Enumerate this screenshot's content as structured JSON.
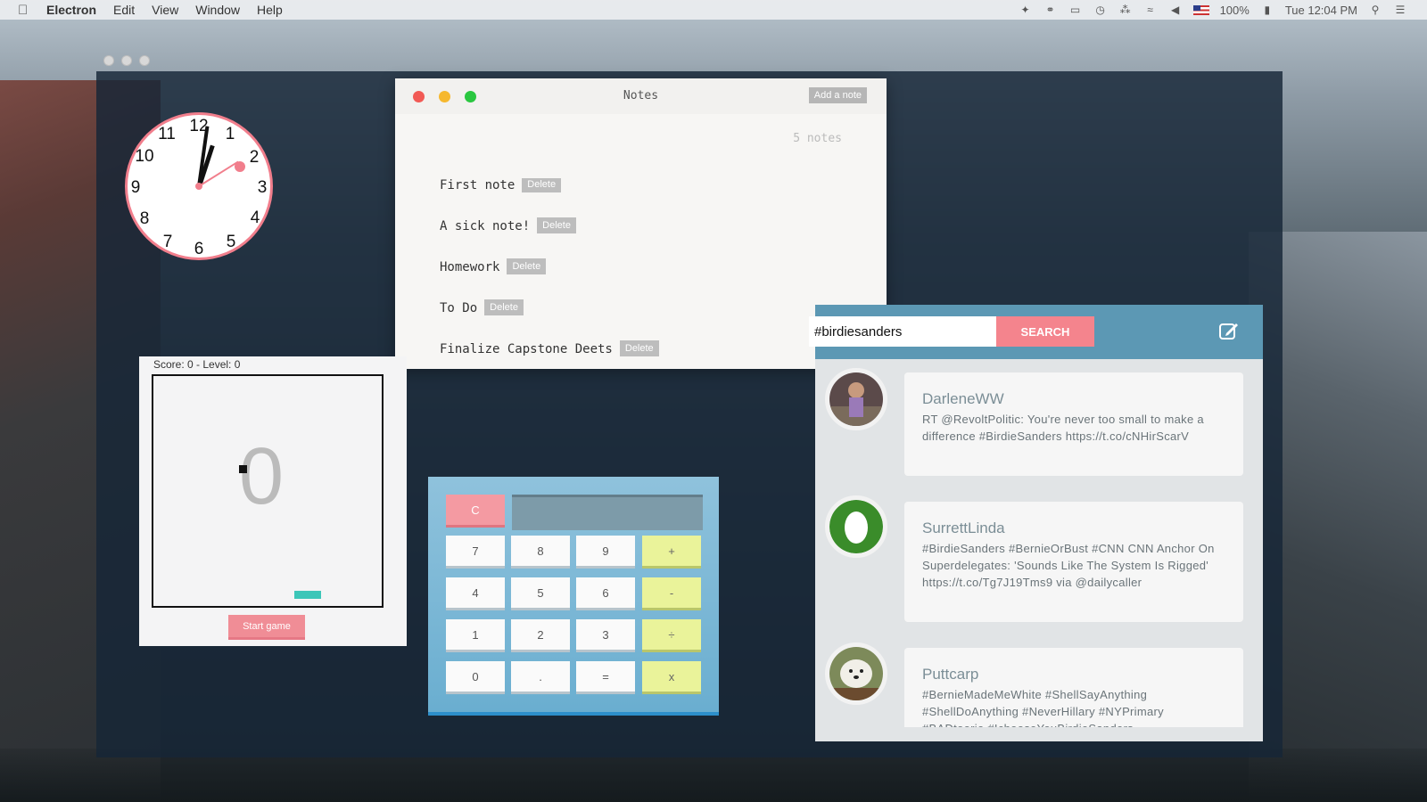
{
  "menubar": {
    "app": "Electron",
    "items": [
      "Edit",
      "View",
      "Window",
      "Help"
    ],
    "battery": "100%",
    "time": "Tue 12:04 PM"
  },
  "clock": {
    "numbers": [
      "12",
      "1",
      "2",
      "3",
      "4",
      "5",
      "6",
      "7",
      "8",
      "9",
      "10",
      "11"
    ]
  },
  "notes": {
    "title": "Notes",
    "add_label": "Add a note",
    "count": "5 notes",
    "delete_label": "Delete",
    "items": [
      "First note",
      "A sick note!",
      "Homework",
      "To Do",
      "Finalize Capstone Deets"
    ]
  },
  "game": {
    "score_text": "Score: 0 - Level: 0",
    "digit": "0",
    "start_label": "Start game"
  },
  "calculator": {
    "clear": "C",
    "display": "",
    "keys": [
      "7",
      "8",
      "9",
      "+",
      "4",
      "5",
      "6",
      "-",
      "1",
      "2",
      "3",
      "÷",
      "0",
      ".",
      "=",
      "x"
    ]
  },
  "twitter": {
    "search_value": "#birdiesanders",
    "search_label": "SEARCH",
    "tweets": [
      {
        "user": "DarleneWW",
        "text": "RT @RevoltPolitic: You're never too small to make a difference #BirdieSanders https://t.co/cNHirScarV"
      },
      {
        "user": "SurrettLinda",
        "text": "#BirdieSanders #BernieOrBust #CNN CNN Anchor On Superdelegates: 'Sounds Like The System Is Rigged' https://t.co/Tg7J19Tms9 via @dailycaller"
      },
      {
        "user": "Puttcarp",
        "text": "#BernieMadeMeWhite #ShellSayAnything #ShellDoAnything #NeverHillary #NYPrimary #BADtoorie #IchooseYouBirdieSanders"
      }
    ]
  },
  "colors": {
    "accent_pink": "#f17e8c",
    "twitter_header": "#5c98b4",
    "calc_op": "#eaf39a"
  }
}
